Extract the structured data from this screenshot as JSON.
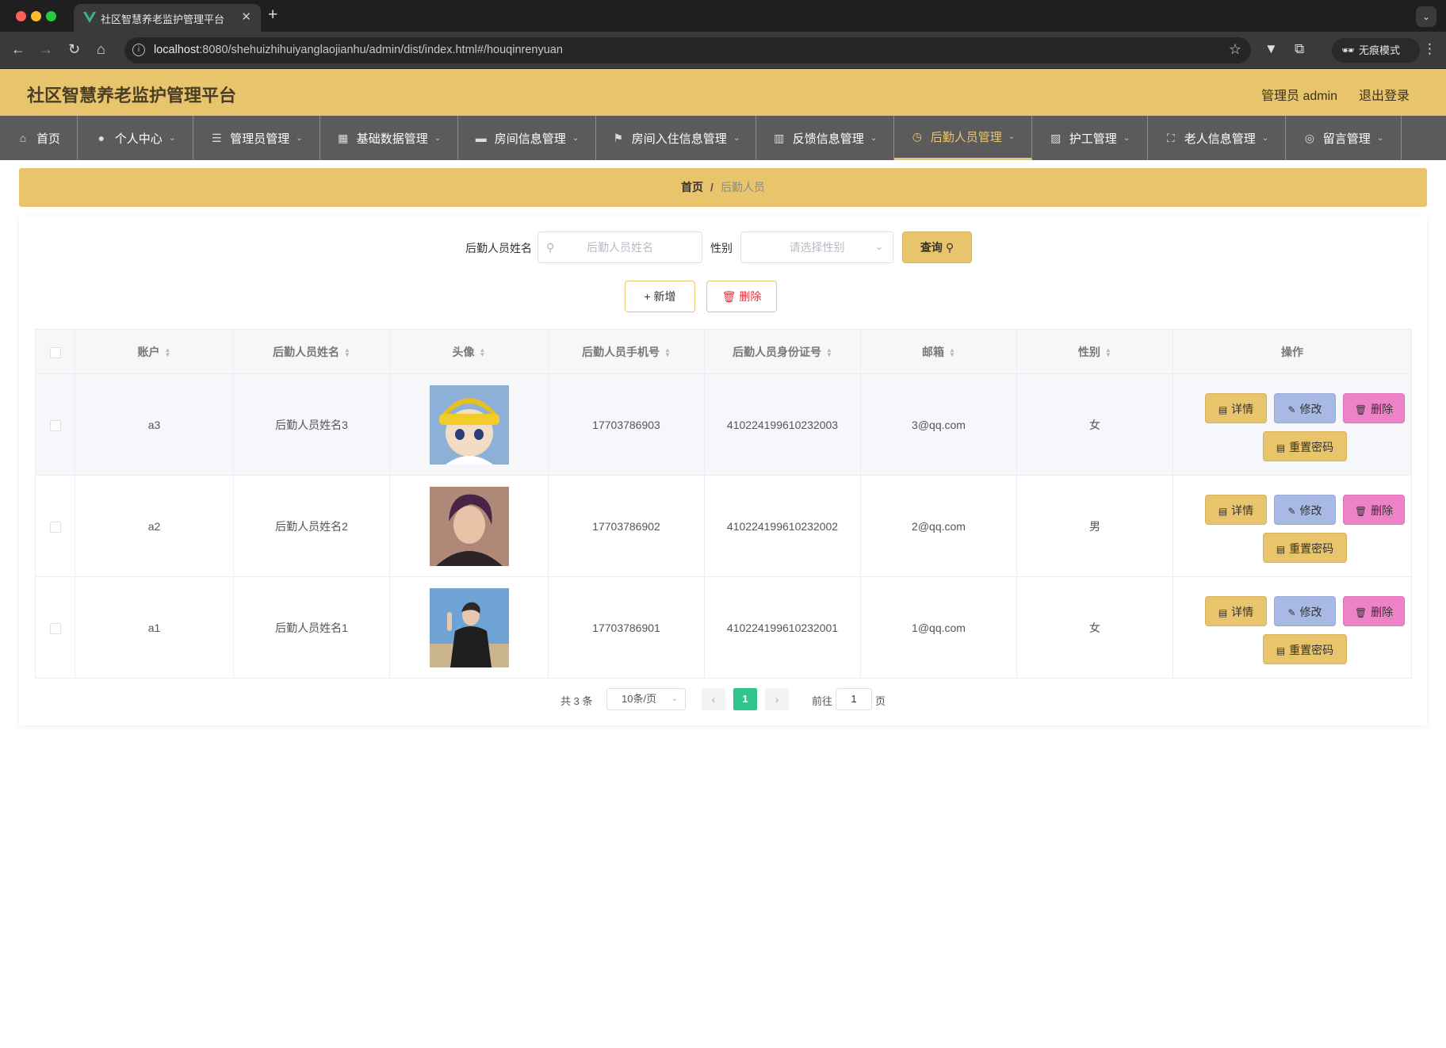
{
  "browser": {
    "tab_title": "社区智慧养老监护管理平台",
    "url_host": "localhost",
    "url_rest": ":8080/shehuizhihuiyanglaojianhu/admin/dist/index.html#/houqinrenyuan",
    "incognito_label": "无痕模式"
  },
  "header": {
    "title": "社区智慧养老监护管理平台",
    "user": "管理员 admin",
    "logout": "退出登录"
  },
  "menu": {
    "items": [
      {
        "label": "首页"
      },
      {
        "label": "个人中心"
      },
      {
        "label": "管理员管理"
      },
      {
        "label": "基础数据管理"
      },
      {
        "label": "房间信息管理"
      },
      {
        "label": "房间入住信息管理"
      },
      {
        "label": "反馈信息管理"
      },
      {
        "label": "后勤人员管理"
      },
      {
        "label": "护工管理"
      },
      {
        "label": "老人信息管理"
      },
      {
        "label": "留言管理"
      }
    ]
  },
  "breadcrumb": {
    "home": "首页",
    "separator": "/",
    "current": "后勤人员"
  },
  "search": {
    "name_label": "后勤人员姓名",
    "name_placeholder": "后勤人员姓名",
    "gender_label": "性别",
    "gender_placeholder": "请选择性别",
    "query_label": "查询"
  },
  "actions": {
    "add": "新增",
    "delete": "删除"
  },
  "table": {
    "headers": [
      "账户",
      "后勤人员姓名",
      "头像",
      "后勤人员手机号",
      "后勤人员身份证号",
      "邮箱",
      "性别",
      "操作"
    ],
    "rows": [
      {
        "account": "a3",
        "name": "后勤人员姓名3",
        "phone": "17703786903",
        "id_card": "410224199610232003",
        "email": "3@qq.com",
        "gender": "女"
      },
      {
        "account": "a2",
        "name": "后勤人员姓名2",
        "phone": "17703786902",
        "id_card": "410224199610232002",
        "email": "2@qq.com",
        "gender": "男"
      },
      {
        "account": "a1",
        "name": "后勤人员姓名1",
        "phone": "17703786901",
        "id_card": "410224199610232001",
        "email": "1@qq.com",
        "gender": "女"
      }
    ],
    "row_actions": {
      "detail": "详情",
      "edit": "修改",
      "delete": "删除",
      "reset": "重置密码"
    }
  },
  "pagination": {
    "total": "共 3 条",
    "page_size": "10条/页",
    "current_page": "1",
    "goto_prefix": "前往",
    "goto_value": "1",
    "goto_suffix": "页"
  },
  "colors": {
    "accent": "#e8c46c",
    "menu_bg": "#5b5b5b",
    "page_active": "#2ec68c",
    "edit": "#a8b9e4",
    "delete": "#ee82c7"
  }
}
